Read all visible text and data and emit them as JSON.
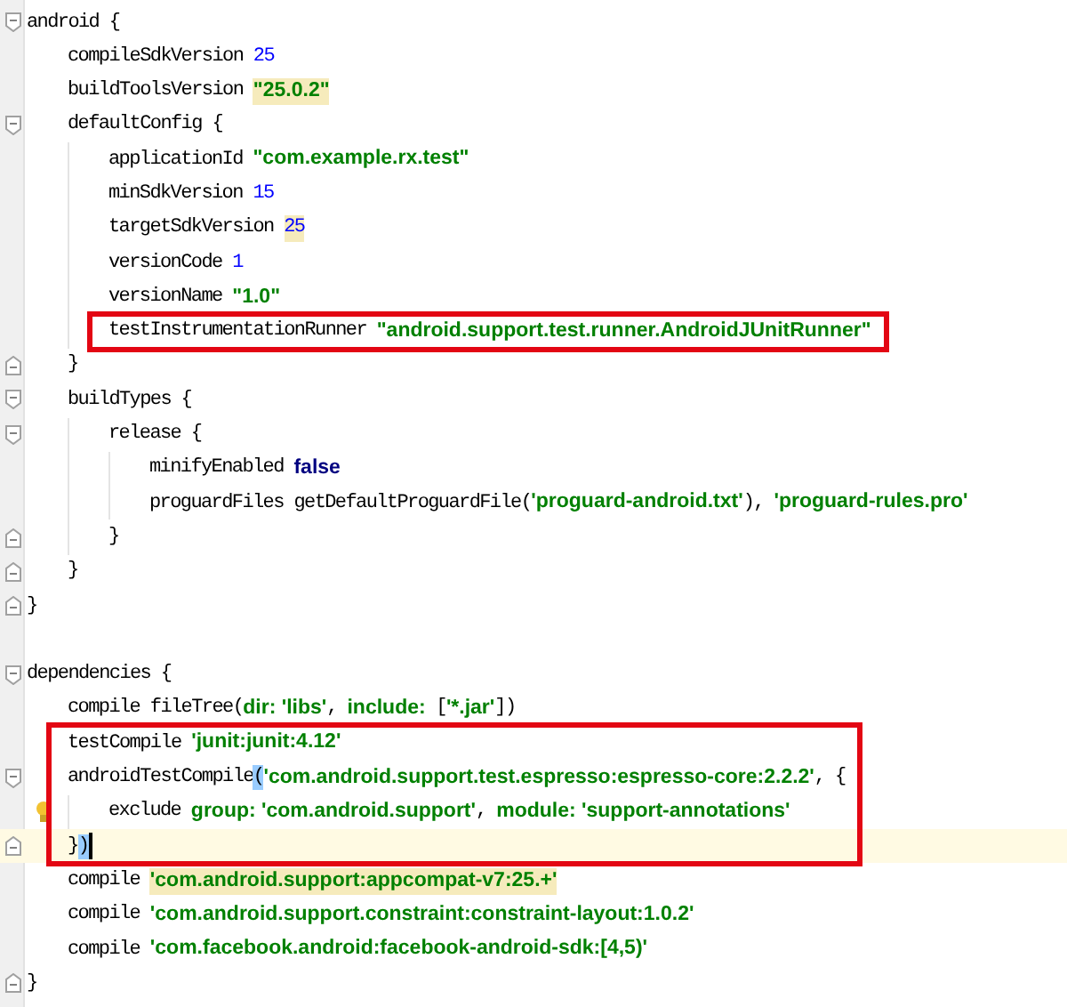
{
  "editor": {
    "lines": [
      {
        "kind": "code",
        "current": false,
        "segments": [
          {
            "kind": "plain",
            "text": "android {"
          }
        ],
        "children": [
          {
            "kind": "code",
            "current": false,
            "segments": [
              {
                "kind": "plain",
                "text": "compileSdkVersion "
              },
              {
                "kind": "number",
                "text": "25"
              }
            ]
          },
          {
            "kind": "code",
            "current": false,
            "segments": [
              {
                "kind": "plain",
                "text": "buildToolsVersion "
              },
              {
                "kind": "string",
                "text": "\"25.0.2\"",
                "warning": true
              }
            ]
          },
          {
            "kind": "code",
            "current": false,
            "segments": [
              {
                "kind": "plain",
                "text": "defaultConfig {"
              }
            ],
            "children": [
              {
                "kind": "code",
                "current": false,
                "segments": [
                  {
                    "kind": "plain",
                    "text": "applicationId "
                  },
                  {
                    "kind": "string",
                    "text": "\"com.example.rx.test\""
                  }
                ]
              },
              {
                "kind": "code",
                "current": false,
                "segments": [
                  {
                    "kind": "plain",
                    "text": "minSdkVersion "
                  },
                  {
                    "kind": "number",
                    "text": "15"
                  }
                ]
              },
              {
                "kind": "code",
                "current": false,
                "segments": [
                  {
                    "kind": "plain",
                    "text": "targetSdkVersion "
                  },
                  {
                    "kind": "number",
                    "text": "25",
                    "warning": true
                  }
                ]
              },
              {
                "kind": "code",
                "current": false,
                "segments": [
                  {
                    "kind": "plain",
                    "text": "versionCode "
                  },
                  {
                    "kind": "number",
                    "text": "1"
                  }
                ]
              },
              {
                "kind": "code",
                "current": false,
                "segments": [
                  {
                    "kind": "plain",
                    "text": "versionName "
                  },
                  {
                    "kind": "string",
                    "text": "\"1.0\""
                  }
                ]
              },
              {
                "kind": "box",
                "children": [
                  {
                    "kind": "code",
                    "current": false,
                    "segments": [
                      {
                        "kind": "plain",
                        "text": "testInstrumentationRunner "
                      },
                      {
                        "kind": "string",
                        "text": "\"android.support.test.runner.AndroidJUnitRunner\""
                      }
                    ]
                  }
                ]
              }
            ]
          },
          {
            "kind": "close",
            "current": false,
            "segments": [
              {
                "kind": "plain",
                "text": "}"
              }
            ]
          },
          {
            "kind": "code",
            "current": false,
            "segments": [
              {
                "kind": "plain",
                "text": "buildTypes {"
              }
            ],
            "children": [
              {
                "kind": "code",
                "current": false,
                "segments": [
                  {
                    "kind": "plain",
                    "text": "release {"
                  }
                ],
                "children": [
                  {
                    "kind": "code",
                    "current": false,
                    "segments": [
                      {
                        "kind": "plain",
                        "text": "minifyEnabled "
                      },
                      {
                        "kind": "keyword",
                        "text": "false"
                      }
                    ]
                  },
                  {
                    "kind": "code",
                    "current": false,
                    "segments": [
                      {
                        "kind": "plain",
                        "text": "proguardFiles getDefaultProguardFile("
                      },
                      {
                        "kind": "string",
                        "text": "'proguard-android.txt'"
                      },
                      {
                        "kind": "plain",
                        "text": "), "
                      },
                      {
                        "kind": "string",
                        "text": "'proguard-rules.pro'"
                      }
                    ]
                  }
                ]
              },
              {
                "kind": "close",
                "current": false,
                "segments": [
                  {
                    "kind": "plain",
                    "text": "}"
                  }
                ]
              }
            ]
          },
          {
            "kind": "close",
            "current": false,
            "segments": [
              {
                "kind": "plain",
                "text": "}"
              }
            ]
          }
        ]
      },
      {
        "kind": "close",
        "current": false,
        "segments": [
          {
            "kind": "plain",
            "text": "}"
          }
        ]
      },
      {
        "kind": "blank",
        "current": false
      },
      {
        "kind": "code",
        "current": false,
        "segments": [
          {
            "kind": "plain",
            "text": "dependencies {"
          }
        ],
        "children": [
          {
            "kind": "code",
            "current": false,
            "segments": [
              {
                "kind": "plain",
                "text": "compile fileTree("
              },
              {
                "kind": "string",
                "text": "dir: 'libs'"
              },
              {
                "kind": "plain",
                "text": ", "
              },
              {
                "kind": "string",
                "text": "include:"
              },
              {
                "kind": "plain",
                "text": " ["
              },
              {
                "kind": "string",
                "text": "'*.jar'"
              },
              {
                "kind": "plain",
                "text": "])"
              }
            ]
          },
          {
            "kind": "box",
            "children": [
              {
                "kind": "code",
                "current": false,
                "segments": [
                  {
                    "kind": "plain",
                    "text": "testCompile "
                  },
                  {
                    "kind": "string",
                    "text": "'junit:junit:4.12'"
                  }
                ]
              },
              {
                "kind": "code",
                "current": false,
                "segments": [
                  {
                    "kind": "plain",
                    "text": "androidTestCompile"
                  },
                  {
                    "kind": "plain",
                    "text": "(",
                    "brace_match": true
                  },
                  {
                    "kind": "string",
                    "text": "'com.android.support.test.espresso:espresso-core:2.2.2'"
                  },
                  {
                    "kind": "plain",
                    "text": ", {"
                  }
                ],
                "children": [
                  {
                    "kind": "code",
                    "current": false,
                    "bulb": true,
                    "segments": [
                      {
                        "kind": "plain",
                        "text": "exclude "
                      },
                      {
                        "kind": "string",
                        "text": "group: 'com.android.support'"
                      },
                      {
                        "kind": "plain",
                        "text": ", "
                      },
                      {
                        "kind": "string",
                        "text": "module: 'support-annotations'"
                      }
                    ]
                  }
                ]
              },
              {
                "kind": "close",
                "current": true,
                "segments": [
                  {
                    "kind": "plain",
                    "text": "}"
                  },
                  {
                    "kind": "plain",
                    "text": ")",
                    "brace_match": true
                  }
                ]
              }
            ]
          },
          {
            "kind": "code",
            "current": false,
            "segments": [
              {
                "kind": "plain",
                "text": "compile "
              },
              {
                "kind": "string",
                "text": "'com.android.support:appcompat-v7:25.+'",
                "warning": true
              }
            ]
          },
          {
            "kind": "code",
            "current": false,
            "segments": [
              {
                "kind": "plain",
                "text": "compile "
              },
              {
                "kind": "string",
                "text": "'com.android.support.constraint:constraint-layout:1.0.2'"
              }
            ]
          },
          {
            "kind": "code",
            "current": false,
            "segments": [
              {
                "kind": "plain",
                "text": "compile "
              },
              {
                "kind": "string",
                "text": "'com.facebook.android:facebook-android-sdk:[4,5)'"
              }
            ]
          }
        ]
      },
      {
        "kind": "close",
        "current": false,
        "segments": [
          {
            "kind": "plain",
            "text": "}"
          }
        ]
      }
    ]
  }
}
